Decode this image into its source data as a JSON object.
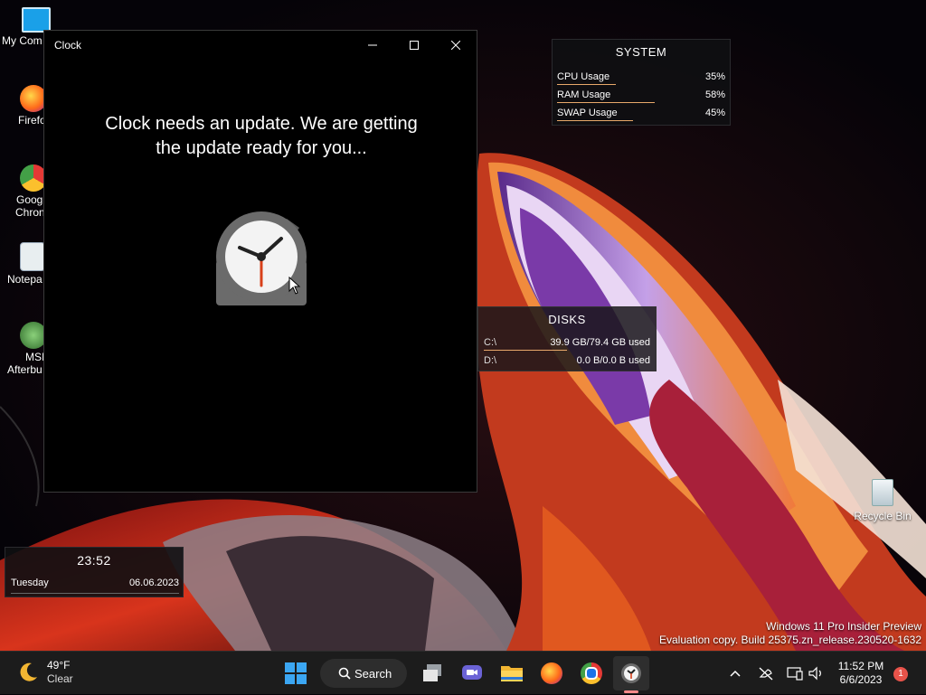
{
  "desktop": {
    "icons": [
      {
        "label": "My Com",
        "icon": "monitor-icon"
      },
      {
        "label": "Firefo",
        "icon": "firefox-icon"
      },
      {
        "label": "Googl",
        "label2": "Chron",
        "icon": "chrome-icon"
      },
      {
        "label": "Notepa",
        "icon": "notepad-icon"
      },
      {
        "label": "MSI",
        "label2": "Afterbu",
        "icon": "msi-afterburner-icon"
      },
      {
        "label": "Recycle Bin",
        "icon": "recycle-bin-icon"
      }
    ]
  },
  "clock_window": {
    "title": "Clock",
    "message_line1": "Clock needs an update. We are getting",
    "message_line2": "the update ready for you...",
    "controls": {
      "minimize": "minimize-icon",
      "maximize": "maximize-icon",
      "close": "close-icon"
    }
  },
  "system_widget": {
    "title": "SYSTEM",
    "rows": [
      {
        "name": "CPU Usage",
        "value": "35%",
        "level": 0.35
      },
      {
        "name": "RAM Usage",
        "value": "58%",
        "level": 0.58
      },
      {
        "name": "SWAP Usage",
        "value": "45%",
        "level": 0.45
      }
    ]
  },
  "disks_widget": {
    "title": "DISKS",
    "rows": [
      {
        "name": "C:\\",
        "value": "39.9 GB/79.4 GB used",
        "level": 0.5
      },
      {
        "name": "D:\\",
        "value": "0.0 B/0.0 B used",
        "level": 0.0
      }
    ]
  },
  "date_widget": {
    "time": "23:52",
    "day": "Tuesday",
    "date": "06.06.2023"
  },
  "watermark": {
    "line1": "Windows 11 Pro Insider Preview",
    "line2": "Evaluation copy. Build 25375.zn_release.230520-1632"
  },
  "taskbar": {
    "weather": {
      "temp": "49°F",
      "condition": "Clear",
      "icon": "moon-icon"
    },
    "search_label": "Search",
    "apps": [
      "start-icon",
      "task-view-icon",
      "teams-icon",
      "file-explorer-icon",
      "firefox-icon",
      "chrome-icon",
      "clock-app-icon"
    ],
    "tray": [
      "chevron-up-icon",
      "network-off-icon",
      "display-icon",
      "volume-icon"
    ],
    "time": "11:52 PM",
    "date": "6/6/2023",
    "notification_count": "1",
    "colors": {
      "accent": "#ff8a8a",
      "badge": "#e8534a",
      "bar": "#e8a86a"
    }
  }
}
